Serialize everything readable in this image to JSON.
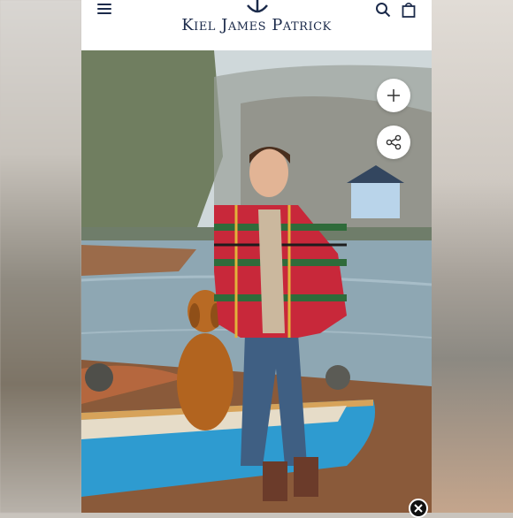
{
  "header": {
    "brand": "Kiel James Patrick",
    "icons": [
      "menu-icon",
      "anchor-icon",
      "search-icon",
      "shopping-bag-icon"
    ]
  },
  "product_image": {
    "controls": [
      "plus-icon",
      "share-icon"
    ]
  },
  "overlay": {
    "close_icon": "close-icon"
  },
  "colors": {
    "brand_navy": "#1b2a4a",
    "canoe_blue": "#2e9bd0",
    "plaid_red": "#c8283a",
    "plaid_green": "#2f6b3a"
  }
}
